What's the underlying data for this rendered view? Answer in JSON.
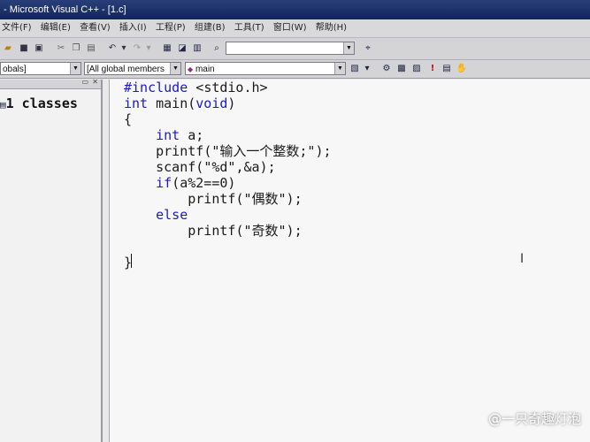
{
  "window": {
    "title": "- Microsoft Visual C++ - [1.c]"
  },
  "menu": [
    {
      "label": "文件(F)"
    },
    {
      "label": "编辑(E)"
    },
    {
      "label": "查看(V)"
    },
    {
      "label": "插入(I)"
    },
    {
      "label": "工程(P)"
    },
    {
      "label": "组建(B)"
    },
    {
      "label": "工具(T)"
    },
    {
      "label": "窗口(W)"
    },
    {
      "label": "帮助(H)"
    }
  ],
  "toolbar2": {
    "scope_value": "obals]",
    "members_value": "[All global members",
    "function_value": "main"
  },
  "left_pane": {
    "label": "1 classes"
  },
  "code_lines": [
    "#include <stdio.h>",
    "int main(void)",
    "{",
    "    int a;",
    "    printf(\"输入一个整数;\");",
    "    scanf(\"%d\",&a);",
    "    if(a%2==0)",
    "        printf(\"偶数\");",
    "    else",
    "        printf(\"奇数\");",
    "",
    "}"
  ],
  "watermark": "@一只奇趣灯泡",
  "colors": {
    "keyword": "#1a1ac8",
    "editor_bg": "#f7f7f7"
  }
}
